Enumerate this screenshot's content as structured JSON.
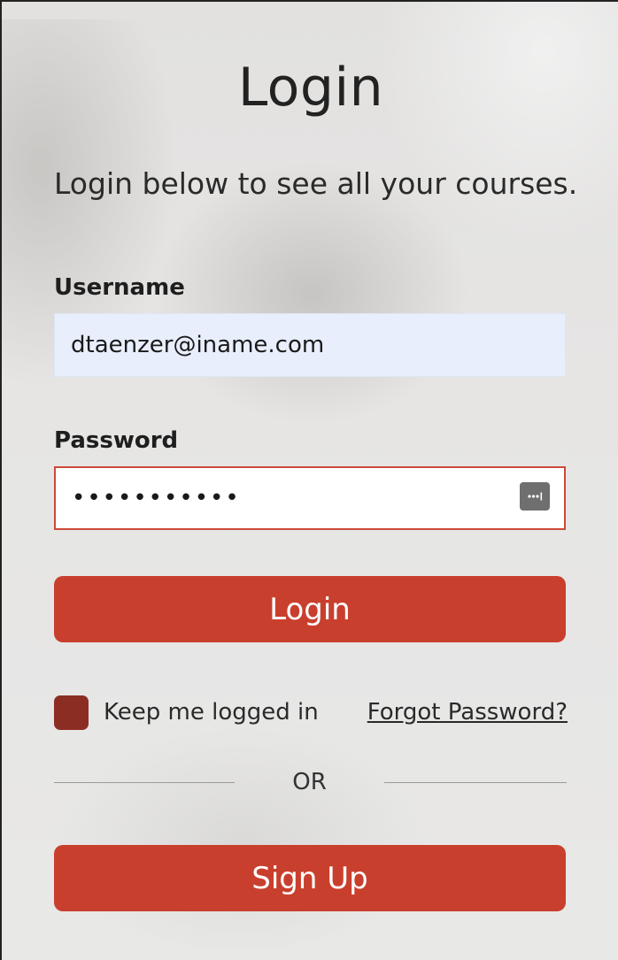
{
  "header": {
    "title": "Login",
    "subtitle": "Login below to see all your courses."
  },
  "form": {
    "username_label": "Username",
    "username_value": "dtaenzer@iname.com",
    "password_label": "Password",
    "password_value": "•••••••••••",
    "login_button": "Login",
    "keep_logged_in_label": "Keep me logged in",
    "forgot_password_link": "Forgot Password?",
    "divider_text": "OR",
    "signup_button": "Sign Up"
  },
  "icons": {
    "password_manager": "password-key-icon"
  },
  "colors": {
    "accent": "#c93f2d",
    "checkbox": "#8c2d23",
    "password_border": "#cc4a3a",
    "username_autofill_bg": "#e8eefc"
  }
}
